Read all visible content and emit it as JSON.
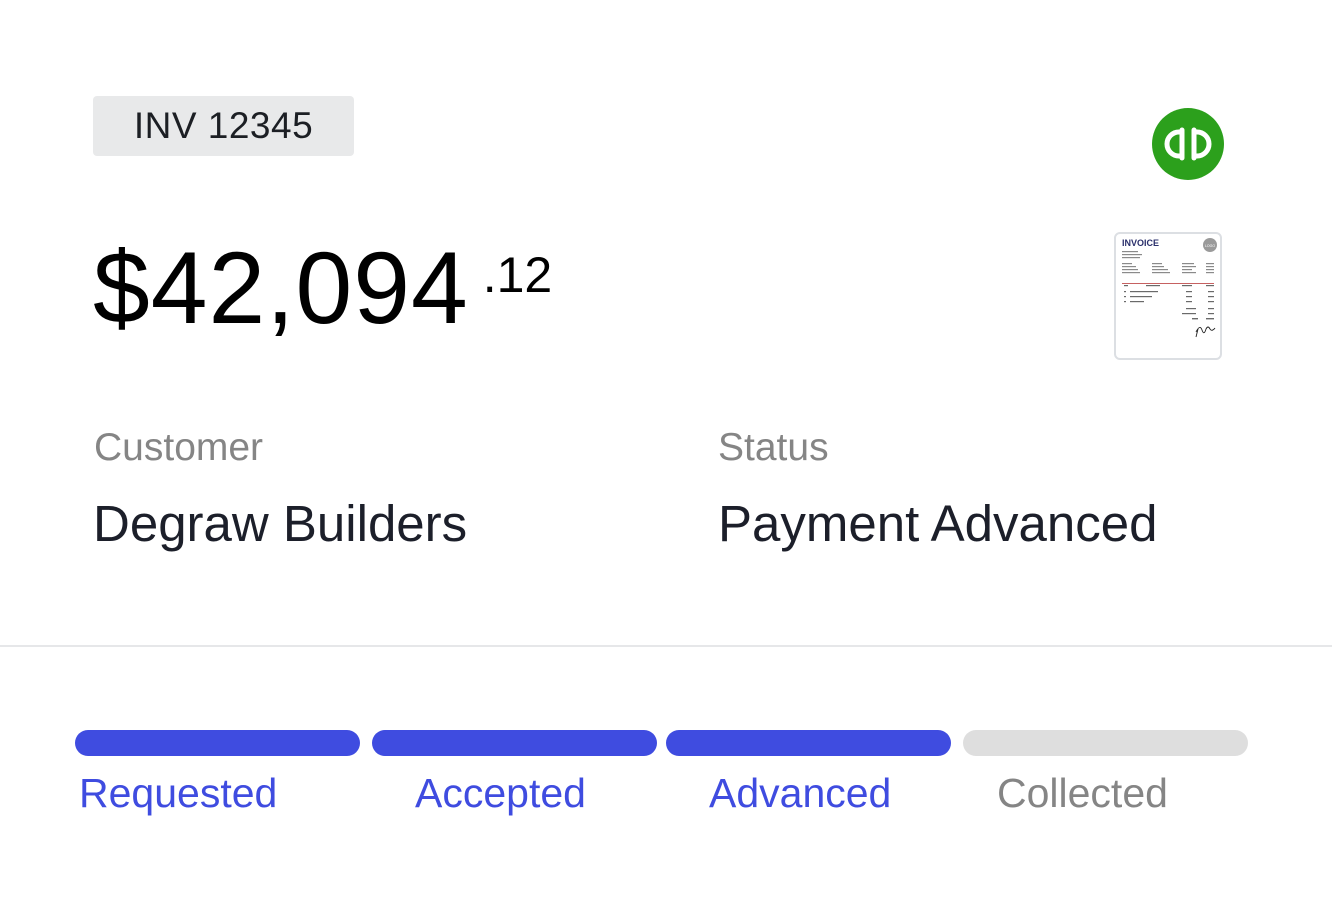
{
  "invoice": {
    "number": "INV 12345",
    "amount_main": "$42,094",
    "amount_cents": ".12",
    "thumbnail": {
      "title": "INVOICE",
      "logo_text": "LOGO"
    }
  },
  "integration": {
    "icon": "quickbooks-icon",
    "color": "#2ca01c"
  },
  "fields": {
    "customer_label": "Customer",
    "customer_value": "Degraw Builders",
    "status_label": "Status",
    "status_value": "Payment Advanced"
  },
  "progress": {
    "active_color": "#3f4ce0",
    "inactive_color": "#dedede",
    "steps": [
      {
        "label": "Requested",
        "complete": true
      },
      {
        "label": "Accepted",
        "complete": true
      },
      {
        "label": "Advanced",
        "complete": true
      },
      {
        "label": "Collected",
        "complete": false
      }
    ]
  }
}
